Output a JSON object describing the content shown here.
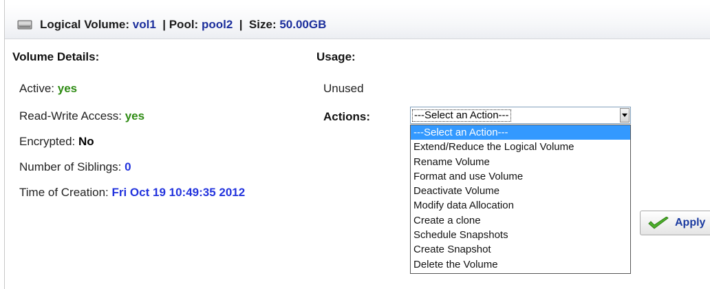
{
  "header": {
    "lv_label": "Logical Volume: ",
    "lv_value": "vol1",
    "pool_label": "  | Pool: ",
    "pool_value": "pool2",
    "size_label": "  |  Size: ",
    "size_value": "50.00GB"
  },
  "details": {
    "title": "Volume Details:",
    "active_label": "Active: ",
    "active_value": "yes",
    "rw_label": "Read-Write Access: ",
    "rw_value": "yes",
    "encrypted_label": "Encrypted: ",
    "encrypted_value": "No",
    "siblings_label": "Number of Siblings: ",
    "siblings_value": "0",
    "creation_label": "Time of Creation: ",
    "creation_value": "Fri Oct 19 10:49:35 2012"
  },
  "usage": {
    "title": "Usage:",
    "value": "Unused"
  },
  "actions": {
    "label": "Actions:",
    "selected": "---Select an Action---",
    "options": [
      "---Select an Action---",
      "Extend/Reduce the Logical Volume",
      "Rename Volume",
      "Format and use Volume",
      "Deactivate Volume",
      "Modify data Allocation",
      "Create a clone",
      "Schedule Snapshots",
      "Create Snapshot",
      "Delete the Volume"
    ],
    "highlighted_index": 0
  },
  "apply_button": {
    "label": "Apply",
    "icon": "checkmark-icon"
  },
  "colors": {
    "header_value": "#1c2f9c",
    "yes_value": "#2e8b13",
    "blue_value": "#2233dd",
    "highlight": "#3399ff"
  }
}
